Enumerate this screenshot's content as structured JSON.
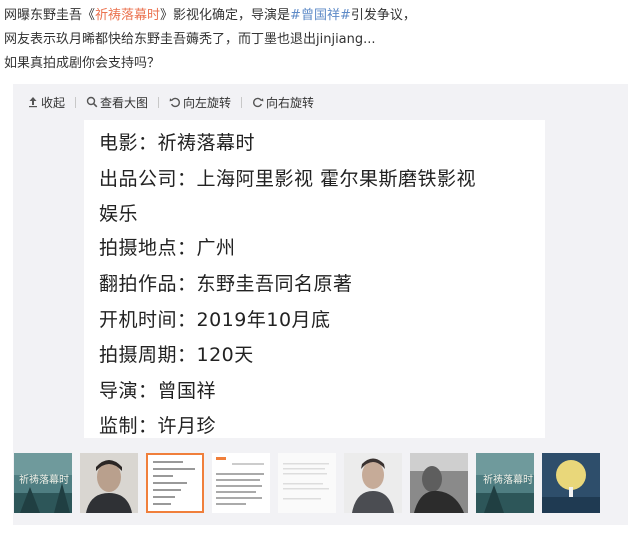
{
  "post": {
    "line1_pre": "网曝东野圭吾《",
    "line1_movie": "祈祷落幕时",
    "line1_mid": "》影视化确定，导演是",
    "line1_tag": "#曾国祥#",
    "line1_post": "引发争议，",
    "line2": "网友表示玖月晞都快给东野圭吾薅秃了，而丁墨也退出jinjiang...",
    "line3": "如果真拍成剧你会支持吗？"
  },
  "toolbar": {
    "collapse": "收起",
    "view_large": "查看大图",
    "rotate_left": "向左旋转",
    "rotate_right": "向右旋转"
  },
  "image": {
    "rows": [
      "电影：祈祷落幕时",
      "出品公司：上海阿里影视 霍尔果斯磨铁影视",
      "娱乐",
      "拍摄地点：广州",
      "翻拍作品：东野圭吾同名原著",
      "开机时间：2019年10月底",
      "拍摄周期：120天",
      "导演：曾国祥",
      "监制：许月珍"
    ]
  },
  "thumbnails": {
    "items": [
      {
        "kind": "poster",
        "title": "祈祷落幕时"
      },
      {
        "kind": "portrait"
      },
      {
        "kind": "text-doc",
        "active": true
      },
      {
        "kind": "text-note"
      },
      {
        "kind": "text-faint"
      },
      {
        "kind": "portrait-light"
      },
      {
        "kind": "bw-photo"
      },
      {
        "kind": "poster",
        "title": "祈祷落幕时"
      },
      {
        "kind": "moon-poster"
      }
    ]
  },
  "colors": {
    "link_orange": "#eb7350",
    "link_blue": "#5d8ac7",
    "active_border": "#f07f3b",
    "viewer_bg": "#f2f2f5"
  }
}
